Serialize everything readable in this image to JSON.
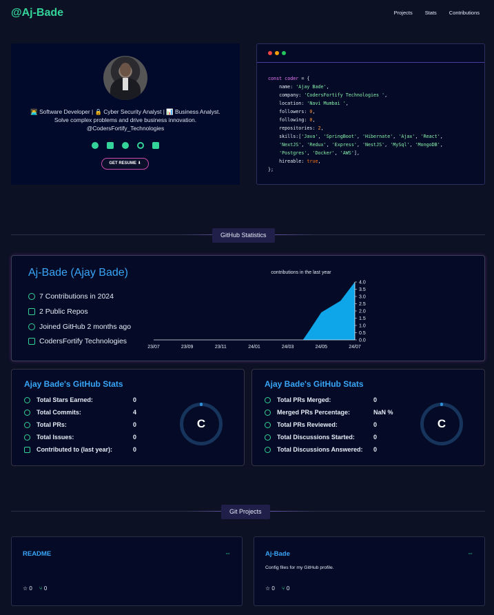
{
  "nav": {
    "brand": "@Aj-Bade",
    "items": [
      "Projects",
      "Stats",
      "Contributions"
    ]
  },
  "profile": {
    "bio_line1": "👨‍💻 Software Developer | 🔒 Cyber Security Analyst | 📊 Business Analyst.",
    "bio_line2": "Solve complex problems and drive business innovation.",
    "bio_line3": "@CodersFortify_Technologies",
    "socials": [
      "github-icon",
      "linkedin-icon",
      "facebook-icon",
      "codepen-icon",
      "twitter-icon"
    ],
    "resume_label": "GET RESUME ⬇"
  },
  "code": {
    "lines": [
      "const coder = {",
      "    name: 'Ajay Bade',",
      "    company: 'CodersFortify Technologies ',",
      "    location: 'Navi Mumbai ',",
      "    followers: 0,",
      "    following: 0,",
      "    repositories: 2,",
      "    skills:['Java', 'SpringBoot', 'Hibernate', 'Ajax', 'React',",
      "    'NextJS', 'Redux', 'Express', 'NestJS', 'MySql', 'MongoDB',",
      "    'Postgres', 'Docker', 'AWS'],",
      "    hireable: true,",
      "};"
    ]
  },
  "sections": {
    "github_stats": "GitHub Statistics",
    "git_projects": "Git Projects"
  },
  "github": {
    "title": "Aj-Bade (Ajay Bade)",
    "contributions": "7 Contributions in 2024",
    "repos": "2 Public Repos",
    "joined": "Joined GitHub 2 months ago",
    "company": "CodersFortify Technologies"
  },
  "chart_data": {
    "type": "area",
    "title": "contributions in the last year",
    "x": [
      "23/07",
      "23/09",
      "23/11",
      "24/01",
      "24/03",
      "24/05",
      "24/07"
    ],
    "values": [
      0,
      0,
      0,
      0,
      0,
      1.9,
      4.0
    ],
    "ylim": [
      0,
      4
    ],
    "yticks": [
      "0.0",
      "0.5",
      "1.0",
      "1.5",
      "2.0",
      "2.5",
      "3.0",
      "3.5",
      "4.0"
    ]
  },
  "stats_left": {
    "title": "Ajay Bade's GitHub Stats",
    "rows": [
      {
        "label": "Total Stars Earned:",
        "value": "0"
      },
      {
        "label": "Total Commits:",
        "value": "4"
      },
      {
        "label": "Total PRs:",
        "value": "0"
      },
      {
        "label": "Total Issues:",
        "value": "0"
      },
      {
        "label": "Contributed to (last year):",
        "value": "0"
      }
    ],
    "grade": "C"
  },
  "stats_right": {
    "title": "Ajay Bade's GitHub Stats",
    "rows": [
      {
        "label": "Total PRs Merged:",
        "value": "0"
      },
      {
        "label": "Merged PRs Percentage:",
        "value": "NaN %"
      },
      {
        "label": "Total PRs Reviewed:",
        "value": "0"
      },
      {
        "label": "Total Discussions Started:",
        "value": "0"
      },
      {
        "label": "Total Discussions Answered:",
        "value": "0"
      }
    ],
    "grade": "C"
  },
  "projects": [
    {
      "title": "README",
      "description": "",
      "stars": "0",
      "forks": "0"
    },
    {
      "title": "Aj-Bade",
      "description": "Config files for my GitHub profile.",
      "stars": "0",
      "forks": "0"
    }
  ],
  "colors": {
    "accent": "#34d399",
    "link": "#38a5f8",
    "background": "#0c1124"
  }
}
